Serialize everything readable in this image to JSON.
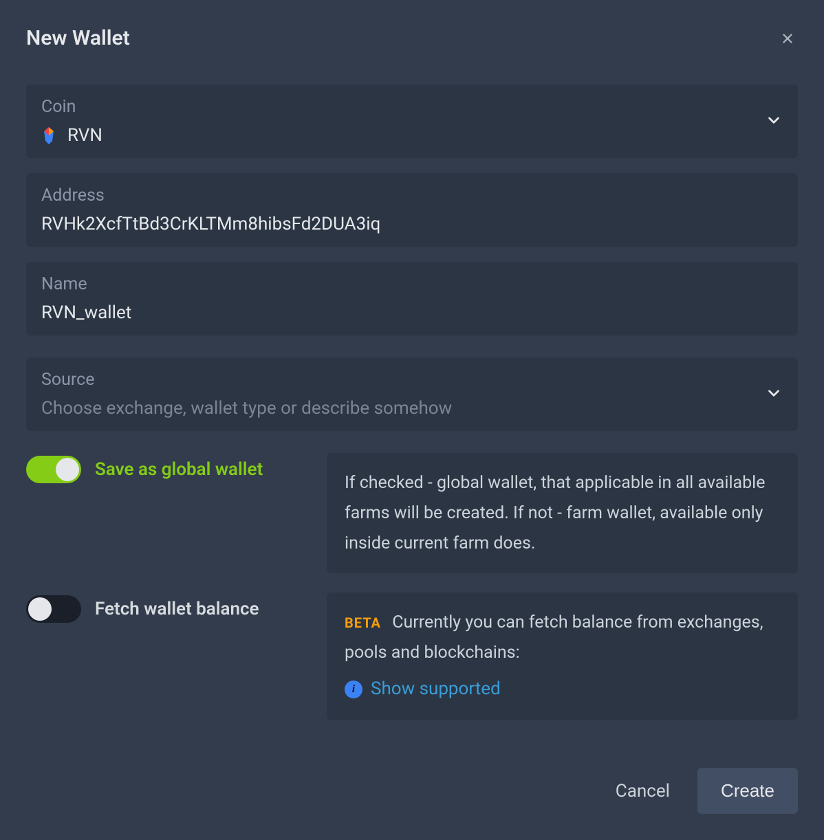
{
  "modal": {
    "title": "New Wallet"
  },
  "fields": {
    "coin": {
      "label": "Coin",
      "value": "RVN",
      "icon": "rvn-icon"
    },
    "address": {
      "label": "Address",
      "value": "RVHk2XcfTtBd3CrKLTMm8hibsFd2DUA3iq"
    },
    "name": {
      "label": "Name",
      "value": "RVN_wallet"
    },
    "source": {
      "label": "Source",
      "placeholder": "Choose exchange, wallet type or describe somehow"
    }
  },
  "toggles": {
    "global_wallet": {
      "label": "Save as global wallet",
      "enabled": true,
      "info": "If checked - global wallet, that applicable in all available farms will be created. If not - farm wallet, available only inside current farm does."
    },
    "fetch_balance": {
      "label": "Fetch wallet balance",
      "enabled": false,
      "beta_label": "BETA",
      "info": "Currently you can fetch balance from exchanges, pools and blockchains:",
      "link_text": "Show supported"
    }
  },
  "footer": {
    "cancel": "Cancel",
    "create": "Create"
  }
}
